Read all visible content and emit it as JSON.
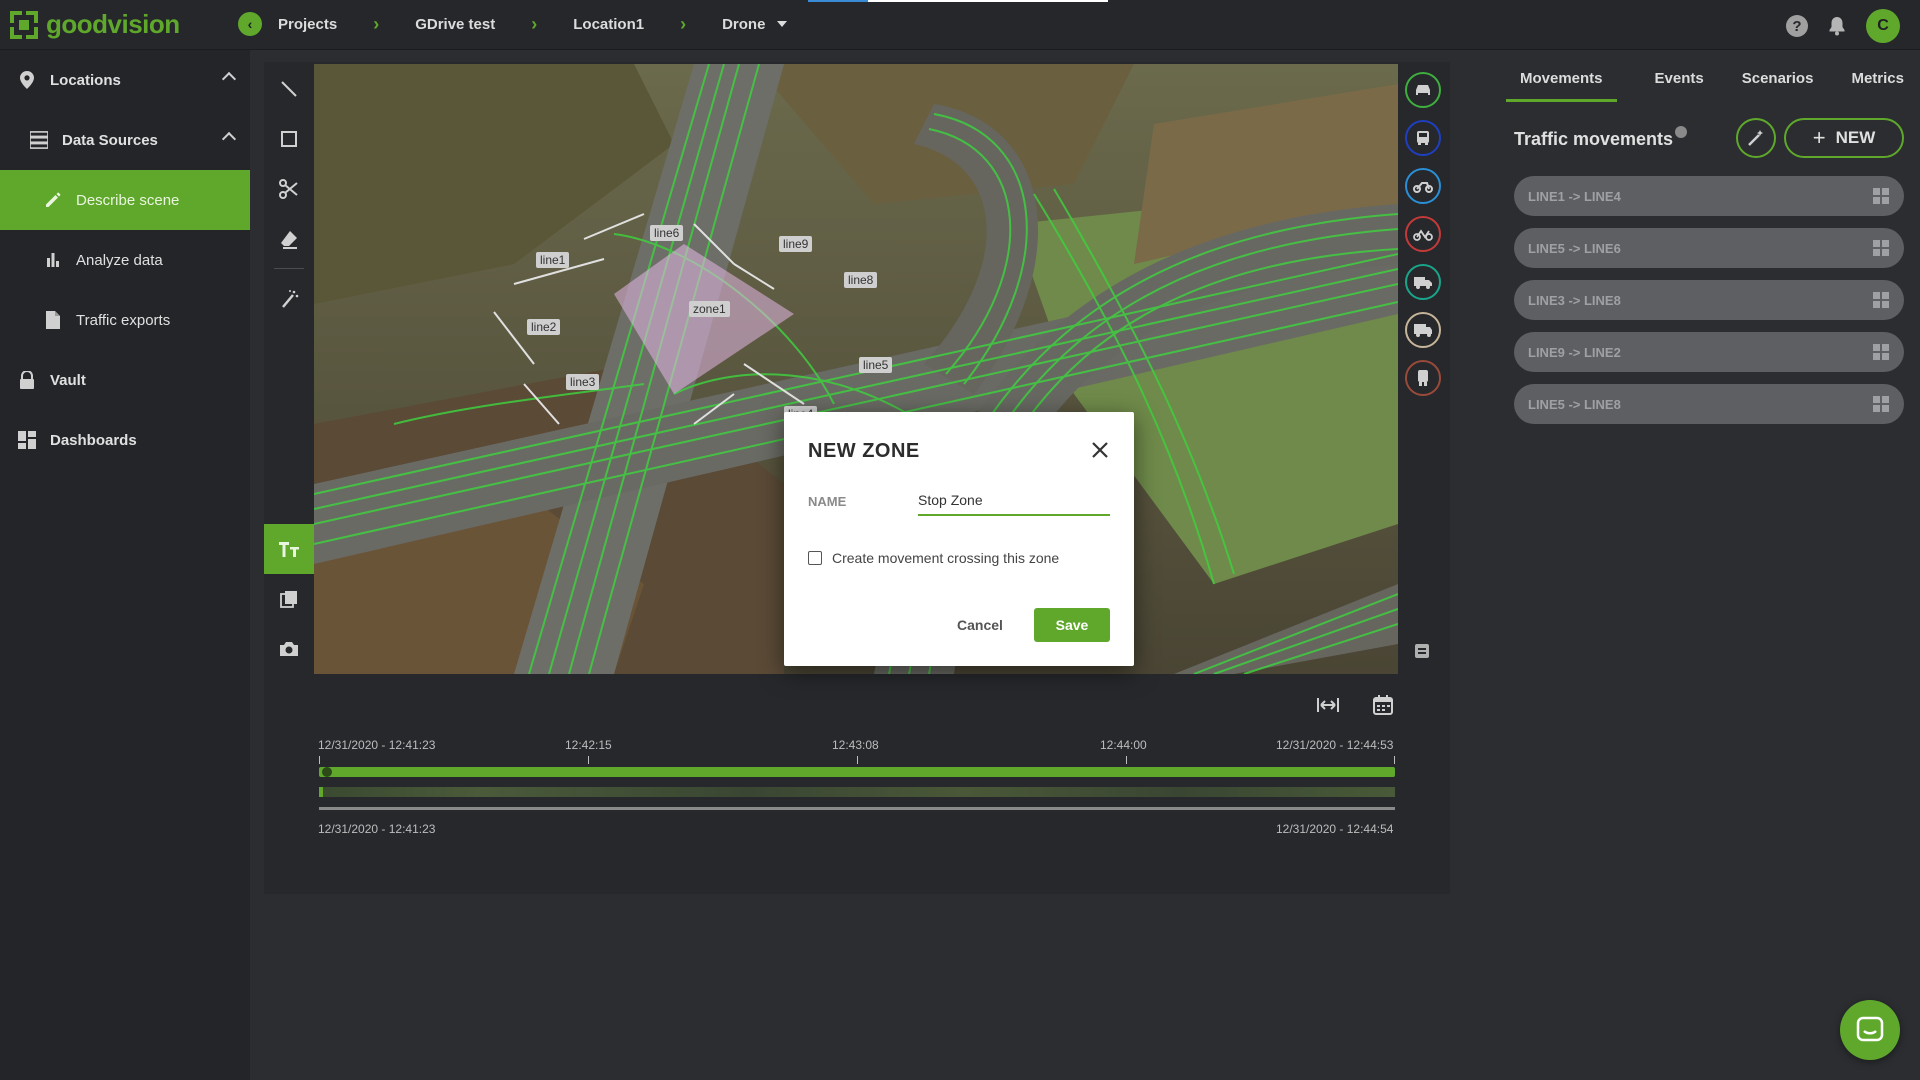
{
  "brand": {
    "name": "goodvision",
    "color": "#5fa82c"
  },
  "breadcrumb": [
    "Projects",
    "GDrive test",
    "Location1",
    "Drone"
  ],
  "user": {
    "initial": "C"
  },
  "sidebar": {
    "items": [
      {
        "label": "Locations",
        "icon": "location-pin-icon",
        "expanded": true
      },
      {
        "label": "Data Sources",
        "icon": "data-sources-icon",
        "expanded": true
      },
      {
        "label": "Describe scene",
        "icon": "pencil-icon",
        "active": true
      },
      {
        "label": "Analyze data",
        "icon": "bar-chart-icon"
      },
      {
        "label": "Traffic exports",
        "icon": "file-icon"
      },
      {
        "label": "Vault",
        "icon": "lock-icon"
      },
      {
        "label": "Dashboards",
        "icon": "dashboard-icon"
      }
    ]
  },
  "tools": [
    "line-tool-icon",
    "rectangle-tool-icon",
    "scissors-icon",
    "eraser-icon",
    "wand-clear-icon",
    "text-size-icon",
    "copy-icon",
    "camera-icon"
  ],
  "scene": {
    "labels": [
      "line1",
      "line2",
      "line3",
      "line5",
      "line6",
      "line8",
      "line9",
      "line4",
      "zone1"
    ]
  },
  "vehicle_classes": [
    {
      "name": "car",
      "color": "#3fae3f"
    },
    {
      "name": "bus",
      "color": "#1f3fbf"
    },
    {
      "name": "motorcycle",
      "color": "#2b8fd6"
    },
    {
      "name": "bicycle",
      "color": "#c43a3a"
    },
    {
      "name": "van",
      "color": "#1aa58a"
    },
    {
      "name": "truck",
      "color": "#c7b59a"
    },
    {
      "name": "pedestrian",
      "color": "#9a4a3a"
    }
  ],
  "timeline": {
    "top_labels": [
      "12/31/2020 - 12:41:23",
      "12:42:15",
      "12:43:08",
      "12:44:00",
      "12/31/2020 - 12:44:53"
    ],
    "bottom_start": "12/31/2020 - 12:41:23",
    "bottom_end": "12/31/2020 - 12:44:54"
  },
  "right_panel": {
    "tabs": [
      "Movements",
      "Events",
      "Scenarios",
      "Metrics"
    ],
    "active_tab": "Movements",
    "title": "Traffic movements",
    "new_label": "NEW",
    "movements": [
      "LINE1 -> LINE4",
      "LINE5 -> LINE6",
      "LINE3 -> LINE8",
      "LINE9 -> LINE2",
      "LINE5 -> LINE8"
    ]
  },
  "modal": {
    "title": "NEW ZONE",
    "name_label": "NAME",
    "name_value": "Stop Zone",
    "checkbox_label": "Create movement crossing this zone",
    "cancel_label": "Cancel",
    "save_label": "Save"
  }
}
